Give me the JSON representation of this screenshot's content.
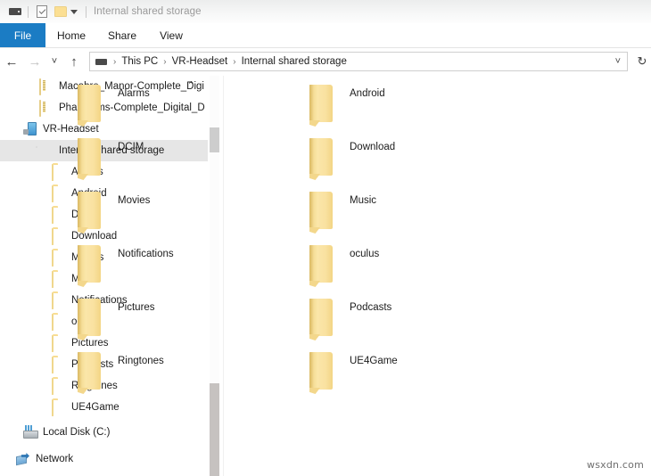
{
  "window": {
    "title": "Internal shared storage",
    "quick_access": {
      "drive_icon": "drive-icon",
      "properties_icon": "properties-checkbox-icon",
      "folder_icon": "folder-icon",
      "customize_icon": "chevron-down-icon"
    }
  },
  "ribbon": {
    "tabs": [
      {
        "label": "File",
        "active": true
      },
      {
        "label": "Home",
        "active": false
      },
      {
        "label": "Share",
        "active": false
      },
      {
        "label": "View",
        "active": false
      }
    ],
    "file_tab_color": "#1b7cc4"
  },
  "navigation": {
    "back_icon": "arrow-left-icon",
    "forward_icon": "arrow-right-icon",
    "recent_icon": "chevron-down-icon",
    "up_icon": "arrow-up-icon",
    "dropdown_icon": "chevron-down-icon",
    "refresh_icon": "refresh-icon",
    "breadcrumb": [
      "This PC",
      "VR-Headset",
      "Internal shared storage"
    ],
    "separator": "›"
  },
  "sidebar": {
    "items": [
      {
        "label": "Macabre_Manor-Complete_Digi",
        "icon": "zip-archive-icon",
        "indent": 44,
        "selected": false,
        "truncated": true
      },
      {
        "label": "Phantasms-Complete_Digital_D",
        "icon": "zip-archive-icon",
        "indent": 44,
        "selected": false,
        "truncated": true
      },
      {
        "label": "VR-Headset",
        "icon": "portable-device-icon",
        "indent": 26,
        "selected": false,
        "truncated": false
      },
      {
        "label": "Internal shared storage",
        "icon": "phone-storage-icon",
        "indent": 44,
        "selected": true,
        "truncated": false
      },
      {
        "label": "Alarms",
        "icon": "folder-icon",
        "indent": 58,
        "selected": false,
        "truncated": false
      },
      {
        "label": "Android",
        "icon": "folder-icon",
        "indent": 58,
        "selected": false,
        "truncated": false
      },
      {
        "label": "DCIM",
        "icon": "folder-icon",
        "indent": 58,
        "selected": false,
        "truncated": false
      },
      {
        "label": "Download",
        "icon": "folder-icon",
        "indent": 58,
        "selected": false,
        "truncated": false
      },
      {
        "label": "Movies",
        "icon": "folder-icon",
        "indent": 58,
        "selected": false,
        "truncated": false
      },
      {
        "label": "Music",
        "icon": "folder-icon",
        "indent": 58,
        "selected": false,
        "truncated": false
      },
      {
        "label": "Notifications",
        "icon": "folder-icon",
        "indent": 58,
        "selected": false,
        "truncated": false
      },
      {
        "label": "oculus",
        "icon": "folder-icon",
        "indent": 58,
        "selected": false,
        "truncated": false
      },
      {
        "label": "Pictures",
        "icon": "folder-icon",
        "indent": 58,
        "selected": false,
        "truncated": false
      },
      {
        "label": "Podcasts",
        "icon": "folder-icon",
        "indent": 58,
        "selected": false,
        "truncated": false
      },
      {
        "label": "Ringtones",
        "icon": "folder-icon",
        "indent": 58,
        "selected": false,
        "truncated": false
      },
      {
        "label": "UE4Game",
        "icon": "folder-icon",
        "indent": 58,
        "selected": false,
        "truncated": false
      },
      {
        "label": "Local Disk (C:)",
        "icon": "local-disk-icon",
        "indent": 26,
        "selected": false,
        "truncated": false
      },
      {
        "label": "Network",
        "icon": "network-icon",
        "indent": 18,
        "selected": false,
        "truncated": false
      }
    ],
    "scroll_up_chevron": "chevron-up-icon",
    "selection_color": "#e6e6e6"
  },
  "files": {
    "view": "large-icons",
    "columns": 2,
    "items": [
      {
        "name": "Alarms",
        "icon": "folder-icon"
      },
      {
        "name": "Android",
        "icon": "folder-icon"
      },
      {
        "name": "DCIM",
        "icon": "folder-icon"
      },
      {
        "name": "Download",
        "icon": "folder-icon"
      },
      {
        "name": "Movies",
        "icon": "folder-icon"
      },
      {
        "name": "Music",
        "icon": "folder-icon"
      },
      {
        "name": "Notifications",
        "icon": "folder-icon"
      },
      {
        "name": "oculus",
        "icon": "folder-icon"
      },
      {
        "name": "Pictures",
        "icon": "folder-icon"
      },
      {
        "name": "Podcasts",
        "icon": "folder-icon"
      },
      {
        "name": "Ringtones",
        "icon": "folder-icon"
      },
      {
        "name": "UE4Game",
        "icon": "folder-icon"
      }
    ]
  },
  "watermark": {
    "text": "wsxdn.com"
  }
}
